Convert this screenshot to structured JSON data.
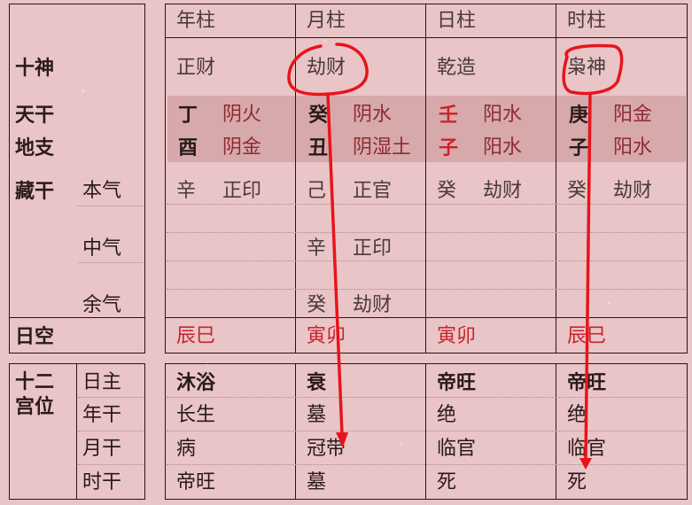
{
  "left_labels": {
    "ten_gods": "十神",
    "heavenly_stem": "天干",
    "earthly_branch": "地支",
    "hidden_stems": "藏干",
    "main_qi": "本气",
    "middle_qi": "中气",
    "residual_qi": "余气",
    "void": "日空",
    "twelve_palaces": [
      "十二",
      "宫位"
    ],
    "palace_rows": [
      "日主",
      "年干",
      "月干",
      "时干"
    ]
  },
  "pillars": [
    {
      "header": "年柱",
      "ten_god": "正财",
      "stem": "丁",
      "stem_element": "阴火",
      "stem_color": "black",
      "branch": "酉",
      "branch_element": "阴金",
      "branch_color": "black",
      "hidden": [
        {
          "stem": "辛",
          "god": "正印"
        },
        null,
        null
      ],
      "void": "辰巳",
      "palaces": [
        "沐浴",
        "长生",
        "病",
        "帝旺"
      ]
    },
    {
      "header": "月柱",
      "ten_god": "劫财",
      "stem": "癸",
      "stem_element": "阴水",
      "stem_color": "black",
      "branch": "丑",
      "branch_element": "阴湿土",
      "branch_color": "black",
      "hidden": [
        {
          "stem": "己",
          "god": "正官"
        },
        {
          "stem": "辛",
          "god": "正印"
        },
        {
          "stem": "癸",
          "god": "劫财"
        }
      ],
      "void": "寅卯",
      "palaces": [
        "衰",
        "墓",
        "冠带",
        "墓"
      ]
    },
    {
      "header": "日柱",
      "ten_god": "乾造",
      "stem": "壬",
      "stem_element": "阳水",
      "stem_color": "red",
      "branch": "子",
      "branch_element": "阳水",
      "branch_color": "red",
      "hidden": [
        {
          "stem": "癸",
          "god": "劫财"
        },
        null,
        null
      ],
      "void": "寅卯",
      "palaces": [
        "帝旺",
        "绝",
        "临官",
        "死"
      ]
    },
    {
      "header": "时柱",
      "ten_god": "枭神",
      "stem": "庚",
      "stem_element": "阳金",
      "stem_color": "black",
      "branch": "子",
      "branch_element": "阳水",
      "branch_color": "black",
      "hidden": [
        {
          "stem": "癸",
          "god": "劫财"
        },
        null,
        null
      ],
      "void": "辰巳",
      "palaces": [
        "帝旺",
        "绝",
        "临官",
        "死"
      ]
    }
  ],
  "annotations": [
    {
      "type": "circle-and-arrow",
      "from": "月柱 十神 劫财",
      "to": "月柱 月干 冠带",
      "color": "#e8141c"
    },
    {
      "type": "circle-and-arrow",
      "from": "时柱 十神 枭神",
      "to": "时柱 时干 死",
      "color": "#e8141c"
    }
  ],
  "colors": {
    "background": "#e9c5c7",
    "shaded_band": "#d7a9ab",
    "red_text": "#c9242b",
    "element_text": "#8e2b31",
    "annotation": "#e8141c"
  }
}
